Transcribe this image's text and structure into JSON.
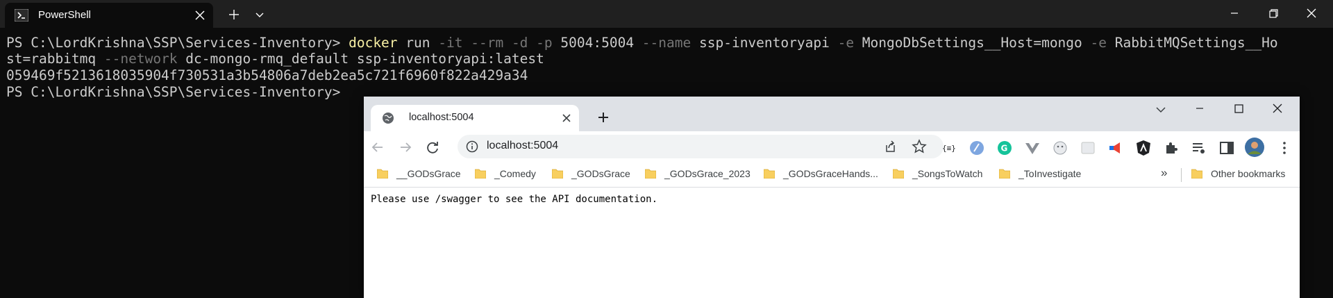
{
  "terminal": {
    "tab_title": "PowerShell",
    "prompt1": "PS C:\\LordKrishna\\SSP\\Services-Inventory> ",
    "cmd": {
      "docker": "docker",
      "run": " run ",
      "it": "-it",
      "rm": " --rm ",
      "d": "-d ",
      "p": "-p",
      "port": " 5004:5004 ",
      "name_flag": "--name",
      "name_val": " ssp-inventoryapi ",
      "e1": "-e",
      "e1_val": " MongoDbSettings__Host=mongo ",
      "e2": "-e",
      "e2_val": " RabbitMQSettings__Ho",
      "cont_val": "st=rabbitmq ",
      "network_flag": "--network",
      "network_val": " dc-mongo-rmq_default ssp-inventoryapi:latest"
    },
    "output_hash": "059469f521361803590­4f730531a3b54806a7deb2ea5c721f6960f822a429a34",
    "prompt2": "PS C:\\LordKrishna\\SSP\\Services-Inventory>"
  },
  "browser": {
    "tab_title": "localhost:5004",
    "url": "localhost:5004",
    "bookmarks": [
      "__GODsGrace",
      "_Comedy",
      "_GODsGrace",
      "_GODsGrace_2023",
      "_GODsGraceHands...",
      "_SongsToWatch",
      "_ToInvestigate"
    ],
    "more_bookmarks": "»",
    "other_bookmarks": "Other bookmarks",
    "page_text": "Please use /swagger to see the API documentation."
  }
}
